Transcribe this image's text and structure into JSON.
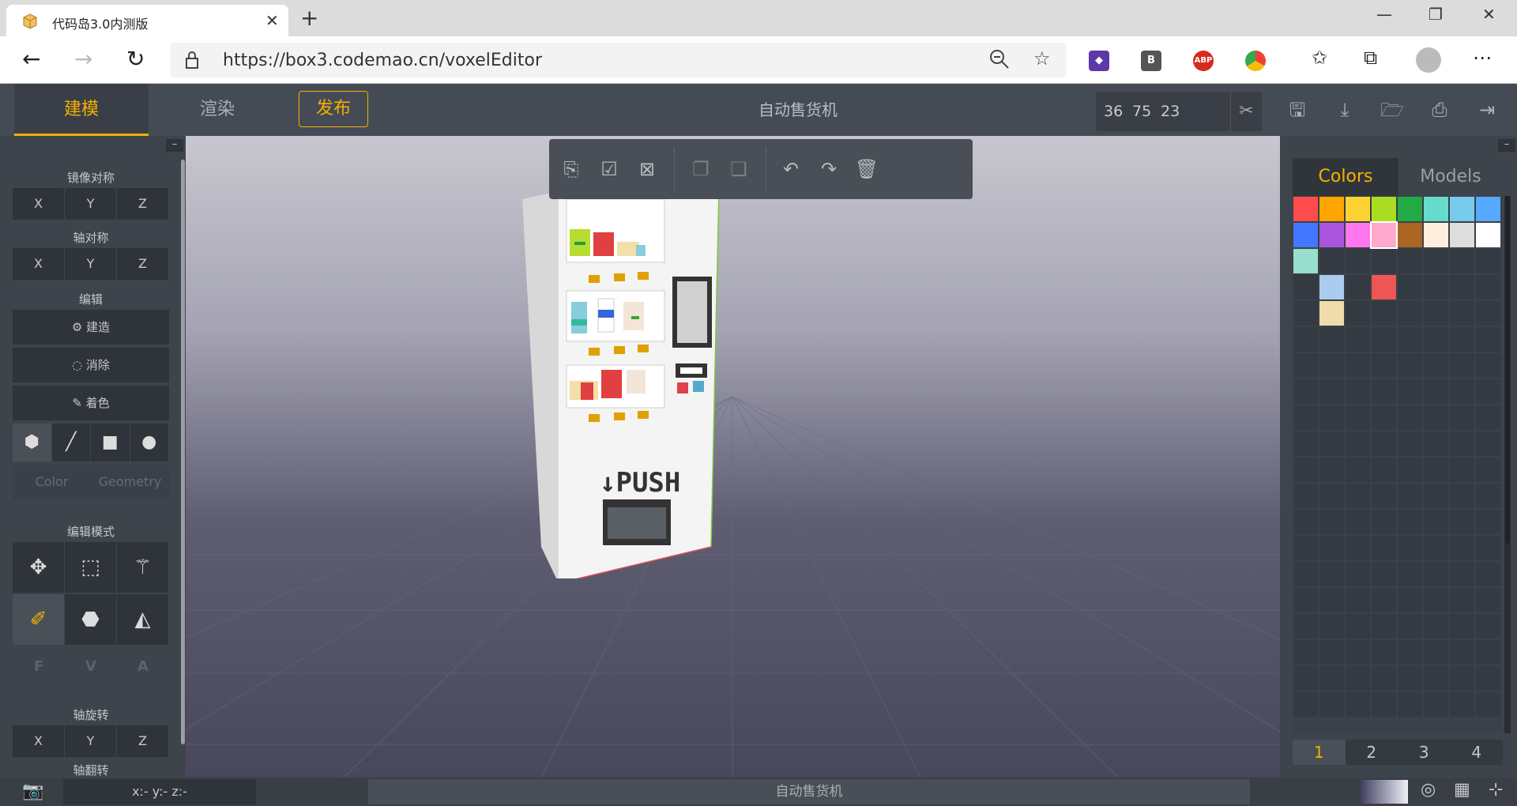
{
  "browser": {
    "tab_title": "代码岛3.0内测版",
    "url": "https://box3.codemao.cn/voxelEditor",
    "extensions": [
      "B",
      "ABP"
    ]
  },
  "header": {
    "tabs": {
      "model": "建模",
      "render": "渲染"
    },
    "publish": "发布",
    "title": "自动售货机",
    "dims": {
      "x": "36",
      "y": "75",
      "z": "23"
    }
  },
  "left": {
    "mirror": {
      "label": "镜像对称",
      "x": "X",
      "y": "Y",
      "z": "Z"
    },
    "axis_sym": {
      "label": "轴对称",
      "x": "X",
      "y": "Y",
      "z": "Z"
    },
    "edit": {
      "label": "编辑",
      "build": "建造",
      "erase": "消除",
      "paint": "着色"
    },
    "color_tab": "Color",
    "geometry_tab": "Geometry",
    "edit_mode": {
      "label": "编辑模式"
    },
    "fva": {
      "f": "F",
      "v": "V",
      "a": "A"
    },
    "axis_rotate": {
      "label": "轴旋转",
      "x": "X",
      "y": "Y",
      "z": "Z"
    },
    "axis_flip": {
      "label": "轴翻转"
    }
  },
  "right": {
    "tabs": {
      "colors": "Colors",
      "models": "Models"
    },
    "swatches": [
      "#ff4d4d",
      "#ffa500",
      "#ffd233",
      "#aadd22",
      "#22aa44",
      "#66ddcc",
      "#77ccee",
      "#55aaff",
      "#4477ff",
      "#aa55dd",
      "#ff77ee",
      "#ffaacc",
      "#aa6622",
      "#ffeedd",
      "#dddddd",
      "#ffffff",
      "#99ddcc"
    ],
    "extra_swatches": [
      {
        "row": 3,
        "col": 1,
        "color": "#aaccee"
      },
      {
        "row": 3,
        "col": 3,
        "color": "#ee5555"
      },
      {
        "row": 4,
        "col": 1,
        "color": "#eeddaa"
      }
    ],
    "selected_swatch": "#ffaacc",
    "pages": [
      "1",
      "2",
      "3",
      "4"
    ]
  },
  "status": {
    "coords": "x:-  y:-  z:-",
    "title": "自动售货机"
  },
  "model": {
    "push_label": "↓PUSH"
  }
}
